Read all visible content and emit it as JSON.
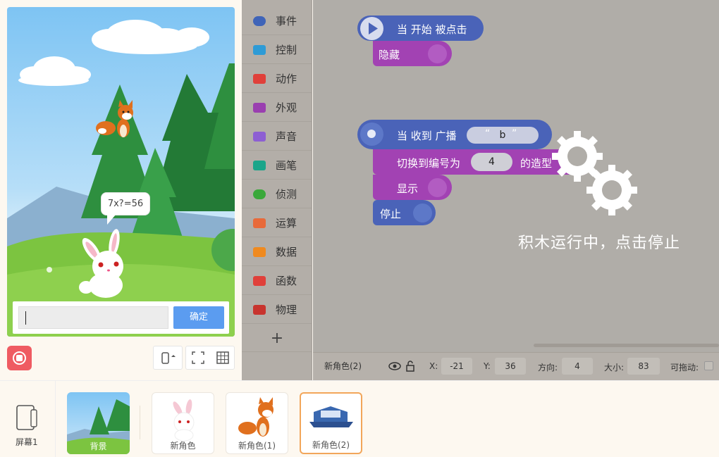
{
  "stage": {
    "bubble_text": "7x?=56",
    "answer_value": "",
    "ok_label": "确定"
  },
  "palette": {
    "categories": [
      {
        "label": "事件",
        "icon": "toggle-icon",
        "color": "#3f64b8"
      },
      {
        "label": "控制",
        "icon": "gamepad-icon",
        "color": "#2e9bd6"
      },
      {
        "label": "动作",
        "icon": "ghost-icon",
        "color": "#e0403a"
      },
      {
        "label": "外观",
        "icon": "shirt-icon",
        "color": "#9a3fb0"
      },
      {
        "label": "声音",
        "icon": "microphone-icon",
        "color": "#8d5fd3"
      },
      {
        "label": "画笔",
        "icon": "pen-icon",
        "color": "#1aa58a"
      },
      {
        "label": "侦测",
        "icon": "target-icon",
        "color": "#3aa83a"
      },
      {
        "label": "运算",
        "icon": "calculator-icon",
        "color": "#e86a3a"
      },
      {
        "label": "数据",
        "icon": "bar-chart-icon",
        "color": "#f08a1f"
      },
      {
        "label": "函数",
        "icon": "function-icon",
        "color": "#e0403a"
      },
      {
        "label": "物理",
        "icon": "magnet-icon",
        "color": "#c8342e"
      }
    ],
    "add_label": "+"
  },
  "script1": {
    "hat_label": "当 开始 被点击",
    "hide_label": "隐藏"
  },
  "script2": {
    "hat_prefix": "当 收到 广播",
    "message": "b",
    "switch_prefix": "切换到编号为",
    "costume_number": "4",
    "switch_suffix": "的造型",
    "show_label": "显示",
    "stop_label": "停止"
  },
  "running_text": "积木运行中，点击停止",
  "props": {
    "sprite_name": "新角色(2)",
    "x_label": "X:",
    "x_value": "-21",
    "y_label": "Y:",
    "y_value": "36",
    "dir_label": "方向:",
    "dir_value": "4",
    "size_label": "大小:",
    "size_value": "83",
    "drag_label": "可拖动:"
  },
  "bottom": {
    "screen_label": "屏幕1",
    "sprites": [
      {
        "label": "背景"
      },
      {
        "label": "新角色"
      },
      {
        "label": "新角色(1)"
      },
      {
        "label": "新角色(2)"
      }
    ]
  },
  "colors": {
    "event_blue": "#4a63b8",
    "looks_purple": "#a242b3",
    "stop_red": "#ef5b62",
    "confirm_blue": "#5b9cf0",
    "selected_orange": "#f2a65a"
  }
}
